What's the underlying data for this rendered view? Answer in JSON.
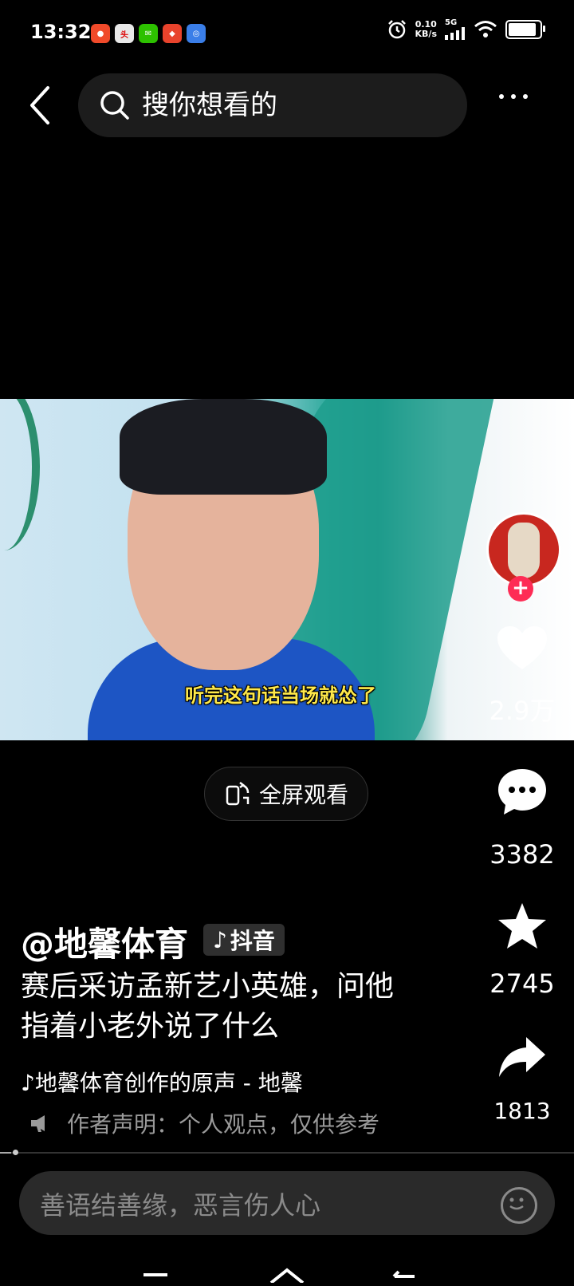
{
  "status": {
    "time": "13:32",
    "net_speed_value": "0.10",
    "net_speed_unit": "KB/s",
    "network": "5G",
    "battery_percent": 90,
    "notification_icons": [
      "toutiao-app-icon",
      "toutiao-news-icon",
      "wechat-icon",
      "red-app-icon",
      "blue-app-icon"
    ]
  },
  "header": {
    "search_placeholder": "搜你想看的"
  },
  "video": {
    "subtitle": "听完这句话当场就怂了"
  },
  "actions": {
    "like_count": "2.9万",
    "comment_count": "3382",
    "favorite_count": "2745",
    "share_count": "1813"
  },
  "fullscreen_label": "全屏观看",
  "post": {
    "author": "@地馨体育",
    "badge": "抖音",
    "description": "赛后采访孟新艺小英雄，问他指着小老外说了什么",
    "music": "地馨体育创作的原声 - 地馨",
    "disclaimer": "作者声明：个人观点，仅供参考"
  },
  "playback_progress": 0.02,
  "comment": {
    "placeholder": "善语结善缘，恶言伤人心"
  },
  "colors": {
    "accent_red": "#fe2c55",
    "background": "#000000"
  }
}
